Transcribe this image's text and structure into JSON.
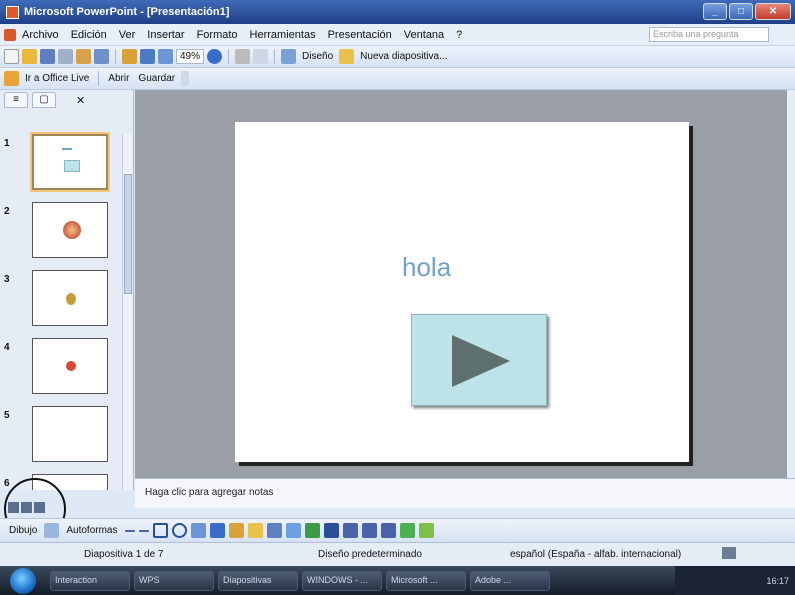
{
  "window": {
    "title": "Microsoft PowerPoint - [Presentación1]"
  },
  "menu": {
    "items": [
      "Archivo",
      "Edición",
      "Ver",
      "Insertar",
      "Formato",
      "Herramientas",
      "Presentación",
      "Ventana",
      "?"
    ],
    "help_placeholder": "Escriba una pregunta"
  },
  "toolbar": {
    "zoom": "49%",
    "design_label": "Diseño",
    "new_slide_label": "Nueva diapositiva..."
  },
  "toolbar2": {
    "office_live": "Ir a Office Live",
    "open": "Abrir",
    "save": "Guardar"
  },
  "slides_panel": {
    "tabs": [
      "Esquema",
      "Diapositivas"
    ],
    "numbers": [
      "1",
      "2",
      "3",
      "4",
      "5",
      "6"
    ]
  },
  "slide": {
    "text": "hola"
  },
  "notes": {
    "placeholder": "Haga clic para agregar notas"
  },
  "drawing_toolbar": {
    "draw_label": "Dibujo",
    "autoshapes_label": "Autoformas"
  },
  "status": {
    "slide": "Diapositiva 1 de 7",
    "design": "Diseño predeterminado",
    "language": "español (España - alfab. internacional)"
  },
  "taskbar": {
    "tasks": [
      "Interaction",
      "WPS",
      "Diapositivas",
      "WINDOWS - ...",
      "Microsoft ...",
      "Adobe ..."
    ],
    "clock": "16:17"
  },
  "colors": {
    "accent": "#6ea3c4",
    "title_bar": "#2a4f9a"
  }
}
